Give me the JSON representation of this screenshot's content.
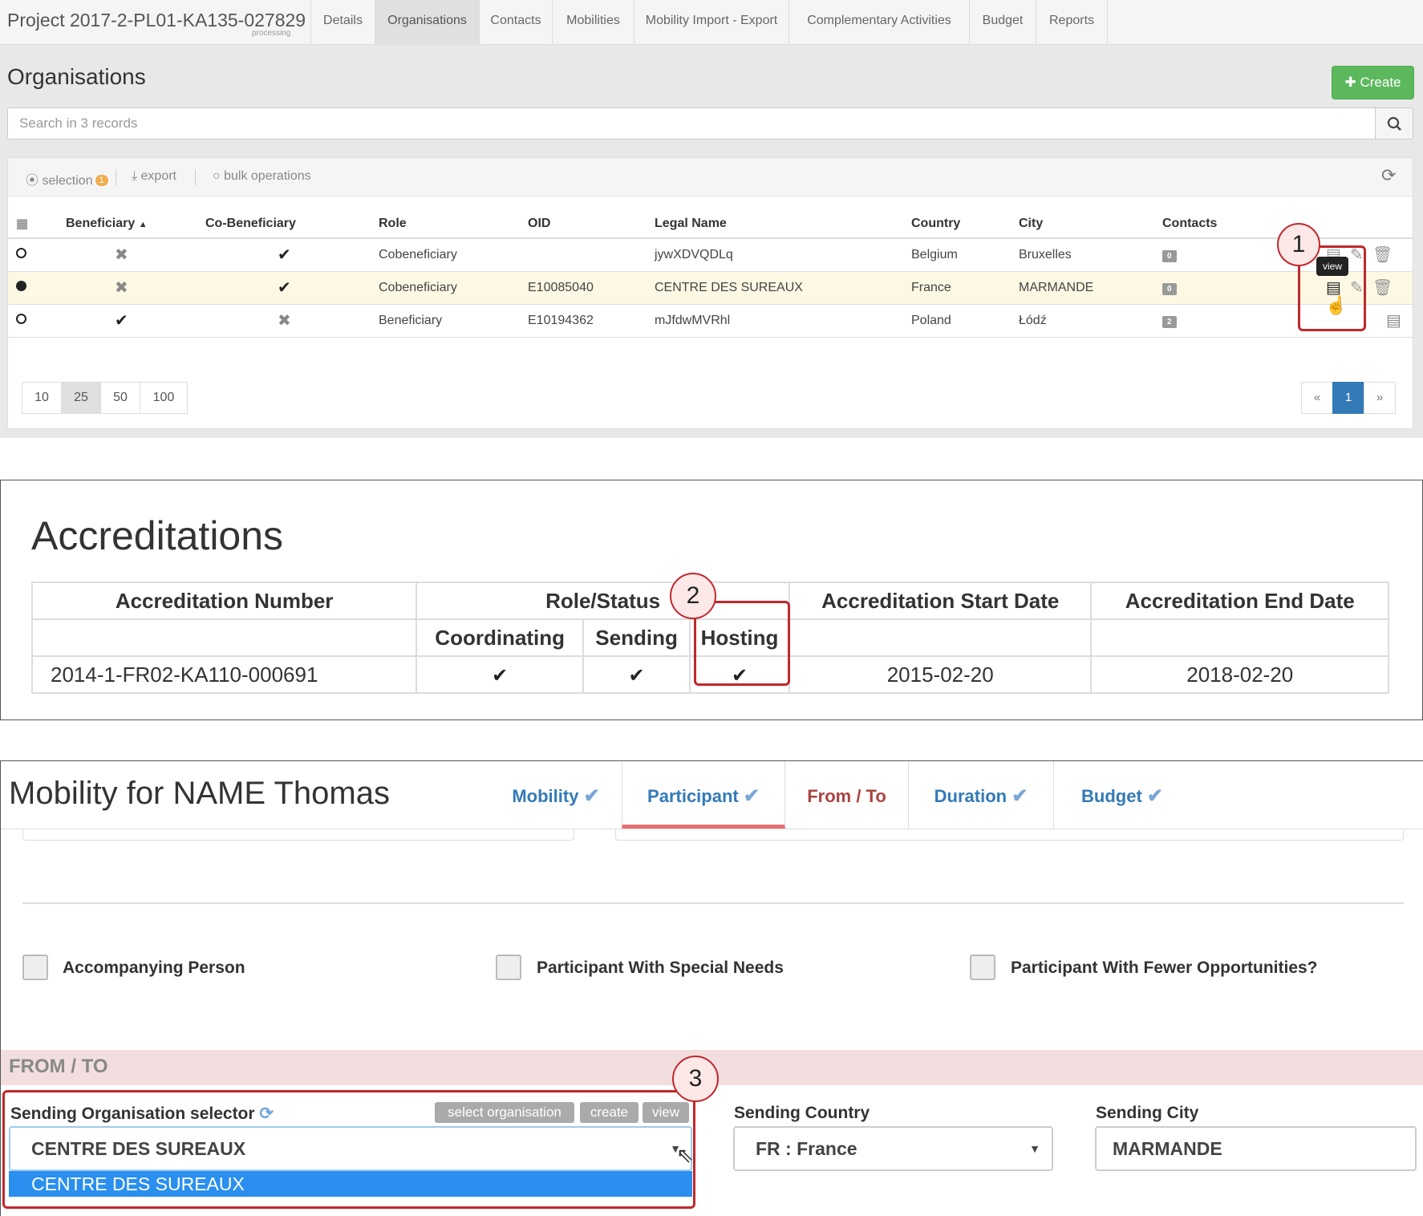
{
  "panel1": {
    "project_title": "Project 2017-2-PL01-KA135-027829",
    "project_status": "processing",
    "tabs": [
      "Details",
      "Organisations",
      "Contacts",
      "Mobilities",
      "Mobility Import - Export",
      "Complementary Activities",
      "Budget",
      "Reports"
    ],
    "active_tab": "Organisations",
    "page_title": "Organisations",
    "create_label": "Create",
    "search_placeholder": "Search in 3 records",
    "toolbar": {
      "selection_label": "selection",
      "selection_count": "1",
      "export_label": "export",
      "bulk_label": "bulk operations"
    },
    "columns": [
      "Beneficiary",
      "Co-Beneficiary",
      "Role",
      "OID",
      "Legal Name",
      "Country",
      "City",
      "Contacts"
    ],
    "rows": [
      {
        "selected": false,
        "beneficiary": false,
        "co_beneficiary": true,
        "role": "Cobeneficiary",
        "oid": "",
        "legal_name": "jywXDVQDLq",
        "country": "Belgium",
        "city": "Bruxelles",
        "contacts": "0"
      },
      {
        "selected": true,
        "beneficiary": false,
        "co_beneficiary": true,
        "role": "Cobeneficiary",
        "oid": "E10085040",
        "legal_name": "CENTRE DES SUREAUX",
        "country": "France",
        "city": "MARMANDE",
        "contacts": "0"
      },
      {
        "selected": false,
        "beneficiary": true,
        "co_beneficiary": false,
        "role": "Beneficiary",
        "oid": "E10194362",
        "legal_name": "mJfdwMVRhl",
        "country": "Poland",
        "city": "Łódź",
        "contacts": "2"
      }
    ],
    "page_sizes": [
      "10",
      "25",
      "50",
      "100"
    ],
    "active_page_size": "25",
    "pager": [
      "«",
      "1",
      "»"
    ],
    "tooltip": "view",
    "callout": "1"
  },
  "panel2": {
    "title": "Accreditations",
    "headers": {
      "number": "Accreditation Number",
      "role_status": "Role/Status",
      "start": "Accreditation Start Date",
      "end": "Accreditation End Date",
      "coordinating": "Coordinating",
      "sending": "Sending",
      "hosting": "Hosting"
    },
    "row": {
      "number": "2014-1-FR02-KA110-000691",
      "coordinating": true,
      "sending": true,
      "hosting": true,
      "start": "2015-02-20",
      "end": "2018-02-20"
    },
    "callout": "2"
  },
  "panel3": {
    "title": "Mobility for NAME Thomas",
    "tabs": [
      {
        "label": "Mobility",
        "done": true
      },
      {
        "label": "Participant",
        "done": true
      },
      {
        "label": "From / To",
        "done": false
      },
      {
        "label": "Duration",
        "done": true
      },
      {
        "label": "Budget",
        "done": true
      }
    ],
    "checkboxes": [
      "Accompanying Person",
      "Participant With Special Needs",
      "Participant With Fewer Opportunities?"
    ],
    "section": "FROM / TO",
    "sending_org_label": "Sending Organisation selector",
    "buttons": [
      "select organisation",
      "create",
      "view"
    ],
    "sending_org_value": "CENTRE DES SUREAUX",
    "sending_org_option": "CENTRE DES SUREAUX",
    "sending_country_label": "Sending Country",
    "sending_country_value": "FR : France",
    "sending_city_label": "Sending City",
    "sending_city_value": "MARMANDE",
    "callout": "3"
  }
}
